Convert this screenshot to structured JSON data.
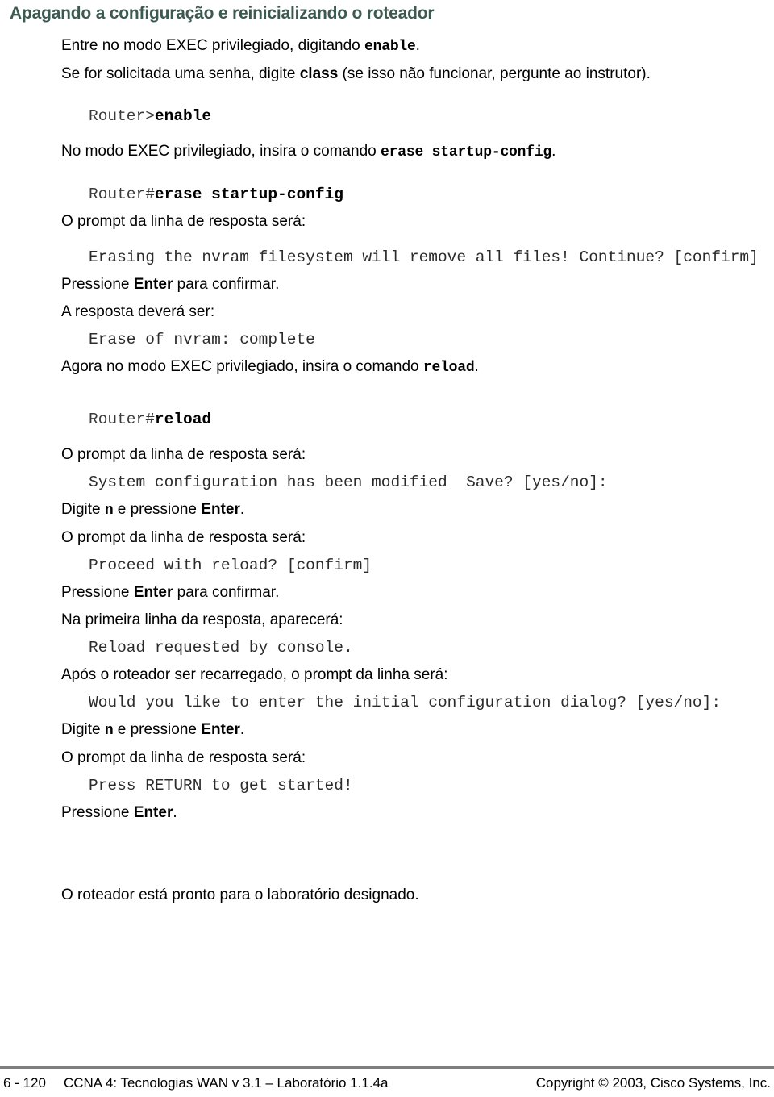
{
  "document": {
    "title": "Apagando a configuração e reinicializando o roteador",
    "title_color": "#3c5a52"
  },
  "blocks": [
    {
      "type": "para",
      "text_pre": "Entre no modo EXEC privilegiado, digitando ",
      "mono": "enable",
      "text_post": "."
    },
    {
      "type": "para",
      "text_pre": "Se for solicitada uma senha, digite ",
      "bold": "class",
      "text_post": " (se isso não funcionar, pergunte ao instrutor)."
    },
    {
      "type": "code",
      "prompt": "Router>",
      "cmd": "enable"
    },
    {
      "type": "para",
      "text_pre": "No modo EXEC privilegiado, insira o comando ",
      "mono": "erase startup-config",
      "text_post": "."
    },
    {
      "type": "code",
      "prompt": "Router#",
      "cmd": "erase startup-config"
    },
    {
      "type": "para",
      "text_pre": "O prompt da linha de resposta será:",
      "mono": "",
      "text_post": ""
    },
    {
      "type": "output",
      "text": "Erasing the nvram filesystem will remove all files! Continue? [confirm]"
    },
    {
      "type": "para",
      "text_pre": "Pressione ",
      "bold": "Enter",
      "text_post": " para confirmar."
    },
    {
      "type": "para",
      "text_pre": "A resposta deverá ser:",
      "mono": "",
      "text_post": ""
    },
    {
      "type": "output",
      "text": "Erase of nvram: complete"
    },
    {
      "type": "para",
      "text_pre": "Agora no modo EXEC privilegiado, insira o comando ",
      "mono": "reload",
      "text_post": "."
    },
    {
      "type": "code",
      "prompt": "Router#",
      "cmd": "reload"
    },
    {
      "type": "para",
      "text_pre": "O prompt da linha de resposta será:",
      "mono": "",
      "text_post": ""
    },
    {
      "type": "output",
      "text": "System configuration has been modified  Save? [yes/no]:"
    },
    {
      "type": "para",
      "text_pre": "Digite ",
      "mono": "n",
      "text_mid": " e pressione ",
      "bold": "Enter",
      "text_post": "."
    },
    {
      "type": "para",
      "text_pre": "O prompt da linha de resposta será:",
      "mono": "",
      "text_post": ""
    },
    {
      "type": "output",
      "text": "Proceed with reload? [confirm]"
    },
    {
      "type": "para",
      "text_pre": "Pressione ",
      "bold": "Enter",
      "text_post": " para confirmar."
    },
    {
      "type": "para",
      "text_pre": "Na primeira linha da resposta, aparecerá:",
      "mono": "",
      "text_post": ""
    },
    {
      "type": "output",
      "text": "Reload requested by console."
    },
    {
      "type": "para",
      "text_pre": "Após o roteador ser recarregado, o prompt da linha será:",
      "mono": "",
      "text_post": ""
    },
    {
      "type": "output",
      "text": "Would you like to enter the initial configuration dialog? [yes/no]:"
    },
    {
      "type": "para",
      "text_pre": "Digite ",
      "mono": "n",
      "text_mid": " e pressione ",
      "bold": "Enter",
      "text_post": "."
    },
    {
      "type": "para",
      "text_pre": "O prompt da linha de resposta será:",
      "mono": "",
      "text_post": ""
    },
    {
      "type": "output",
      "text": "Press RETURN to get started!"
    },
    {
      "type": "para",
      "text_pre": "Pressione ",
      "bold": "Enter",
      "text_post": "."
    },
    {
      "type": "para",
      "text_pre": "O roteador está pronto para o laboratório designado.",
      "mono": "",
      "text_post": ""
    }
  ],
  "lines": {
    "l1_pre": "Entre no modo EXEC privilegiado, digitando ",
    "l1_mono": "enable",
    "l1_post": ".",
    "l2_pre": "Se for solicitada uma senha, digite ",
    "l2_bold": "class",
    "l2_post": " (se isso não funcionar, pergunte ao instrutor).",
    "c1_prompt": "Router>",
    "c1_cmd": "enable",
    "l3_pre": "No modo EXEC privilegiado, insira o comando ",
    "l3_mono": "erase startup-config",
    "l3_post": ".",
    "c2_prompt": "Router#",
    "c2_cmd": "erase startup-config",
    "l4": "O prompt da linha de resposta será:",
    "o1": "Erasing the nvram filesystem will remove all files! Continue? [confirm]",
    "l5_pre": "Pressione ",
    "l5_bold": "Enter",
    "l5_post": " para confirmar.",
    "l6": "A resposta deverá ser:",
    "o2": "Erase of nvram: complete",
    "l7_pre": "Agora no modo EXEC privilegiado, insira o comando ",
    "l7_mono": "reload",
    "l7_post": ".",
    "c3_prompt": "Router#",
    "c3_cmd": "reload",
    "l8": "O prompt da linha de resposta será:",
    "o3": "System configuration has been modified  Save? [yes/no]:",
    "l9_pre": "Digite ",
    "l9_mono": "n",
    "l9_mid": " e pressione ",
    "l9_bold": "Enter",
    "l9_post": ".",
    "l10": "O prompt da linha de resposta será:",
    "o4": "Proceed with reload? [confirm]",
    "l11_pre": "Pressione ",
    "l11_bold": "Enter",
    "l11_post": " para confirmar.",
    "l12": "Na primeira linha da resposta, aparecerá:",
    "o5": "Reload requested by console.",
    "l13": "Após o roteador ser recarregado, o prompt da linha será:",
    "o6": "Would you like to enter the initial configuration dialog? [yes/no]:",
    "l14_pre": "Digite ",
    "l14_mono": "n",
    "l14_mid": " e pressione ",
    "l14_bold": "Enter",
    "l14_post": ".",
    "l15": "O prompt da linha de resposta será:",
    "o7": "Press RETURN to get started!",
    "l16_pre": "Pressione ",
    "l16_bold": "Enter",
    "l16_post": ".",
    "l17": "O roteador está pronto para o laboratório designado."
  },
  "footer": {
    "page_number": "6 - 120",
    "course": "CCNA 4: Tecnologias WAN v 3.1 – Laboratório 1.1.4a",
    "copyright": "Copyright © 2003, Cisco Systems, Inc."
  }
}
